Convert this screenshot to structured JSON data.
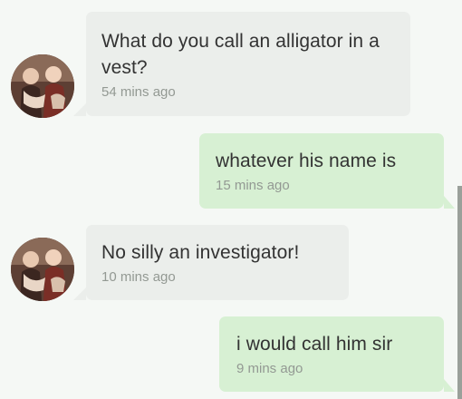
{
  "messages": [
    {
      "direction": "incoming",
      "text": "What do you call an alligator in a vest?",
      "time": "54 mins ago"
    },
    {
      "direction": "outgoing",
      "text": "whatever his name is",
      "time": "15 mins ago"
    },
    {
      "direction": "incoming",
      "text": "No silly an investigator!",
      "time": "10 mins ago"
    },
    {
      "direction": "outgoing",
      "text": "i would call him sir",
      "time": "9 mins ago"
    }
  ],
  "avatar": {
    "icon": "contact-photo-avatar"
  },
  "colors": {
    "background": "#f5f8f5",
    "incoming_bubble": "#ebeeeb",
    "outgoing_bubble": "#d7f0d3",
    "message_text": "#333333",
    "timestamp_text": "#939993"
  }
}
